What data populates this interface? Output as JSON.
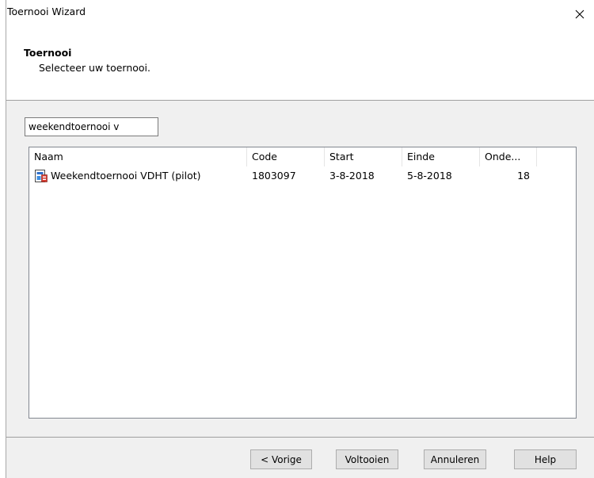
{
  "window": {
    "title": "Toernooi Wizard"
  },
  "header": {
    "title": "Toernooi",
    "subtitle": "Selecteer uw toernooi."
  },
  "search": {
    "value": "weekendtoernooi v"
  },
  "table": {
    "columns": [
      "Naam",
      "Code",
      "Start",
      "Einde",
      "Onde..."
    ],
    "rows": [
      {
        "name": "Weekendtoernooi VDHT (pilot)",
        "code": "1803097",
        "start": "3-8-2018",
        "end": "5-8-2018",
        "count": "18",
        "icon": "tournament-icon"
      }
    ]
  },
  "buttons": {
    "back": "< Vorige",
    "finish": "Voltooien",
    "cancel": "Annuleren",
    "help": "Help"
  },
  "icons": {
    "close": "close-icon"
  }
}
